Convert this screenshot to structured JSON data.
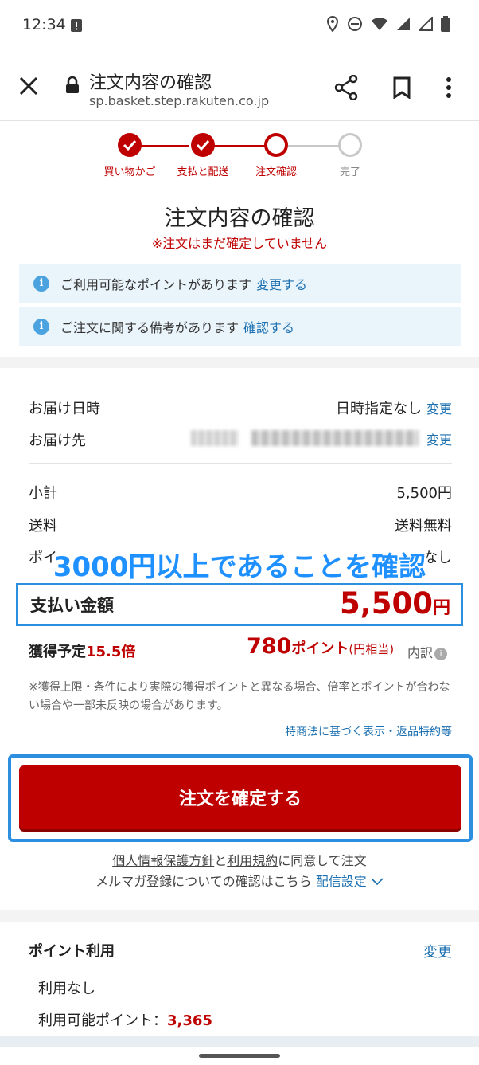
{
  "status_bar": {
    "time": "12:34"
  },
  "browser": {
    "title": "注文内容の確認",
    "url": "sp.basket.step.rakuten.co.jp"
  },
  "stepper": {
    "steps": [
      {
        "label": "買い物かご",
        "state": "done"
      },
      {
        "label": "支払と配送",
        "state": "done"
      },
      {
        "label": "注文確認",
        "state": "current"
      },
      {
        "label": "完了",
        "state": "todo"
      }
    ]
  },
  "header": {
    "title": "注文内容の確認",
    "warning": "※注文はまだ確定していません"
  },
  "notices": [
    {
      "text": "ご利用可能なポイントがあります",
      "link": "変更する"
    },
    {
      "text": "ご注文に関する備考があります",
      "link": "確認する"
    }
  ],
  "delivery": {
    "date_label": "お届け日時",
    "date_value": "日時指定なし",
    "date_link": "変更",
    "address_label": "お届け先",
    "address_link": "変更"
  },
  "summary": {
    "subtotal_label": "小計",
    "subtotal_value": "5,500円",
    "shipping_label": "送料",
    "shipping_value": "送料無料",
    "points_label_partial": "ポイ",
    "points_value_partial": "なし"
  },
  "overlay": {
    "text": "3000円以上であることを確認"
  },
  "total": {
    "label": "支払い金額",
    "amount": "5,500",
    "unit": "円"
  },
  "earn": {
    "label": "獲得予定",
    "multiplier": "15.5倍",
    "points": "780",
    "points_unit": "ポイント",
    "points_sub": "(円相当)",
    "breakdown": "内訳"
  },
  "note": "※獲得上限・条件により実際の獲得ポイントと異なる場合、倍率とポイントが合わない場合や一部未反映の場合があります。",
  "law_link": "特商法に基づく表示・返品特約等",
  "confirm_button": "注文を確定する",
  "agreement": {
    "privacy": "個人情報保護方針",
    "and": "と",
    "terms": "利用規約",
    "agree_text": "に同意して注文",
    "mail_text": "メルマガ登録についての確認はこちら",
    "mail_link": "配信設定"
  },
  "points_section": {
    "title": "ポイント利用",
    "change": "変更",
    "none": "利用なし",
    "available_label": "利用可能ポイント：",
    "available_value": "3,365"
  },
  "colors": {
    "accent": "#bf0000",
    "link": "#1a6fb0",
    "highlight": "#2c8fe0"
  }
}
